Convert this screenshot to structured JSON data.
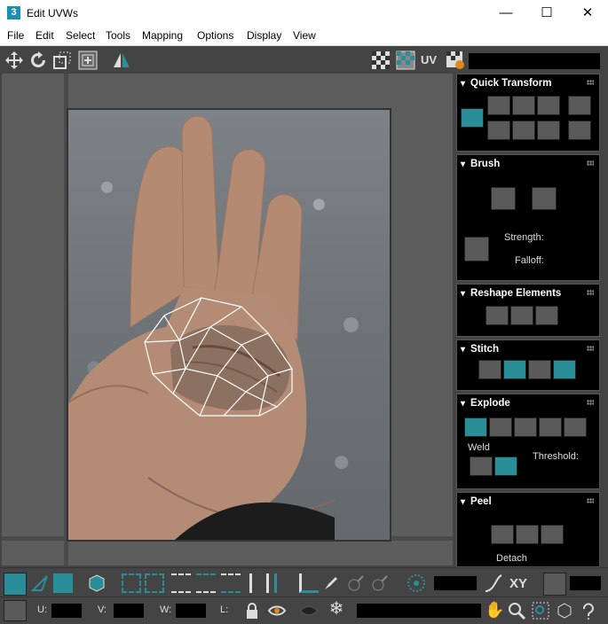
{
  "window": {
    "app_icon": "3",
    "title": "Edit UVWs",
    "minimize": "—",
    "maximize": "☐",
    "close": "✕"
  },
  "menu": [
    "File",
    "Edit",
    "Select",
    "Tools",
    "Mapping",
    "Options",
    "Display",
    "View"
  ],
  "toolbar": {
    "uv_label": "UV"
  },
  "rollouts": {
    "quick_transform": {
      "title": "Quick Transform"
    },
    "brush": {
      "title": "Brush",
      "strength_label": "Strength:",
      "falloff_label": "Falloff:"
    },
    "reshape": {
      "title": "Reshape Elements"
    },
    "stitch": {
      "title": "Stitch"
    },
    "explode": {
      "title": "Explode",
      "weld_label": "Weld",
      "threshold_label": "Threshold:"
    },
    "peel": {
      "title": "Peel",
      "detach_label": "Detach"
    }
  },
  "statusbar": {
    "xy_label": "XY",
    "u_label": "U:",
    "v_label": "V:",
    "w_label": "W:",
    "l_label": "L:"
  },
  "colors": {
    "accent": "#2a8e99",
    "panel_bg": "#000000",
    "ui_bg": "#444444"
  }
}
